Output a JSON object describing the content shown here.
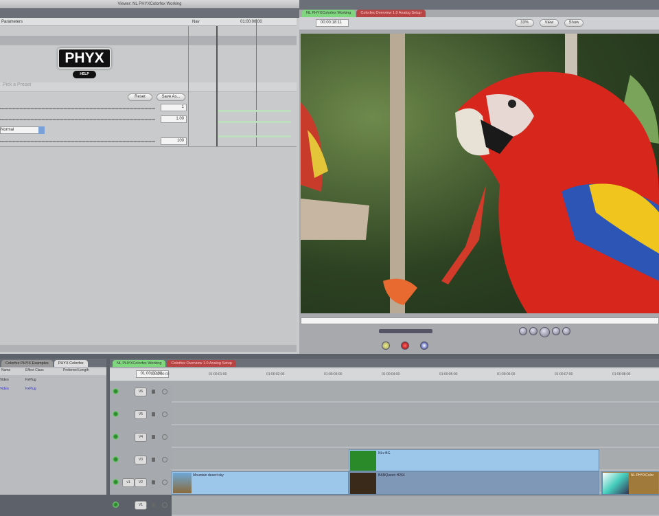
{
  "filter_panel": {
    "window_title": "Viewer: NL PHYXColorfex Working",
    "col_name": "Parameters",
    "col_nav": "Nav",
    "ruler_time": "01:00:00:00",
    "logo": "PHYX",
    "help_label": "HELP",
    "preset_placeholder": "Pick a Preset",
    "reset_label": "Reset",
    "save_as_label": "Save As...",
    "params": [
      {
        "value": "1"
      },
      {
        "value": "1.00"
      },
      {
        "value": "100"
      }
    ],
    "popup_value": "Normal"
  },
  "viewer": {
    "tabs": [
      {
        "label": "NL PHYXColorfex Working",
        "color": "#7fd67f"
      },
      {
        "label": "Colorfex Overview 1.0 Analog Setup",
        "color": "#c44"
      }
    ],
    "timecode": "00:00:18:11",
    "zoom_label": "33%",
    "view_label": "View",
    "overlay_label": "Show"
  },
  "browser": {
    "tabs": [
      "Colorfex PHYX Examples",
      "PHYX Colorfex"
    ],
    "columns": [
      "Name",
      "Effect Class",
      "Preferred Length"
    ],
    "rows": [
      {
        "name": "Video",
        "class": "FxPlug"
      },
      {
        "name": "Video",
        "class": "FxPlug"
      }
    ]
  },
  "timeline": {
    "tabs": [
      {
        "label": "NL PHYXColorfex Working"
      },
      {
        "label": "Colorfex Overview 1.0 Analog Setup"
      }
    ],
    "current_time": "01:00:00:00",
    "ruler": [
      "01:00:00:00",
      "01:00:01:00",
      "01:00:02:00",
      "01:00:03:00",
      "01:00:04:00",
      "01:00:05:00",
      "01:00:06:00",
      "01:00:07:00",
      "01:00:08:00"
    ],
    "tracks": [
      "V6",
      "V5",
      "V4",
      "V3",
      "V2",
      "V1"
    ],
    "source_label": "v1",
    "clips": {
      "v2": "NLx BG",
      "v1a": "Mountain desert sky",
      "v1b": "BANQueen H264",
      "v1c": "NL PHYXColor"
    }
  }
}
